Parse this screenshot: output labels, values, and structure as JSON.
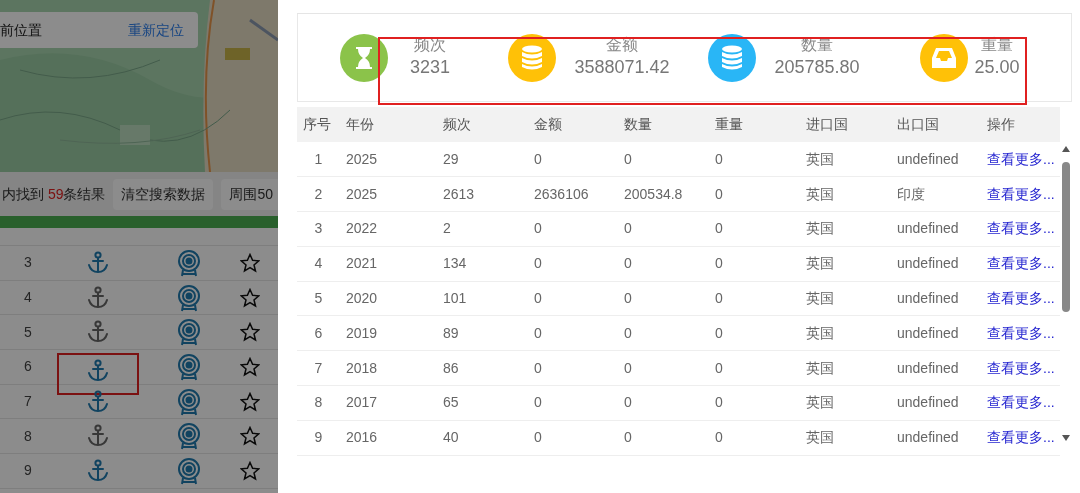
{
  "map_panel": {
    "location_card": {
      "label": "前位置",
      "action": "重新定位"
    },
    "result_bar": {
      "prefix": "内找到 ",
      "count": "59",
      "suffix": "条结果",
      "buttons": [
        "清空搜索数据",
        "周围50"
      ]
    },
    "rows": [
      {
        "index": "3",
        "active": true,
        "highlight": false
      },
      {
        "index": "4",
        "active": false,
        "highlight": false
      },
      {
        "index": "5",
        "active": false,
        "highlight": false
      },
      {
        "index": "6",
        "active": true,
        "highlight": true
      },
      {
        "index": "7",
        "active": true,
        "highlight": false
      },
      {
        "index": "8",
        "active": false,
        "highlight": false
      },
      {
        "index": "9",
        "active": true,
        "highlight": false
      }
    ]
  },
  "stats": {
    "highlight": true,
    "items": [
      {
        "kind": "hourglass",
        "label": "频次",
        "value": "3231",
        "color": "#8bc34a"
      },
      {
        "kind": "database",
        "label": "金额",
        "value": "3588071.42",
        "color": "#ffc107"
      },
      {
        "kind": "database",
        "label": "数量",
        "value": "205785.80",
        "color": "#29b6f6"
      },
      {
        "kind": "inbox",
        "label": "重量",
        "value": "25.00",
        "color": "#ffc107"
      }
    ]
  },
  "table": {
    "columns": [
      "序号",
      "年份",
      "频次",
      "金额",
      "数量",
      "重量",
      "进口国",
      "出口国",
      "操作"
    ],
    "rows": [
      [
        "1",
        "2025",
        "29",
        "0",
        "0",
        "0",
        "英国",
        "undefined",
        "查看更多..."
      ],
      [
        "2",
        "2025",
        "2613",
        "2636106",
        "200534.8",
        "0",
        "英国",
        "印度",
        "查看更多..."
      ],
      [
        "3",
        "2022",
        "2",
        "0",
        "0",
        "0",
        "英国",
        "undefined",
        "查看更多..."
      ],
      [
        "4",
        "2021",
        "134",
        "0",
        "0",
        "0",
        "英国",
        "undefined",
        "查看更多..."
      ],
      [
        "5",
        "2020",
        "101",
        "0",
        "0",
        "0",
        "英国",
        "undefined",
        "查看更多..."
      ],
      [
        "6",
        "2019",
        "89",
        "0",
        "0",
        "0",
        "英国",
        "undefined",
        "查看更多..."
      ],
      [
        "7",
        "2018",
        "86",
        "0",
        "0",
        "0",
        "英国",
        "undefined",
        "查看更多..."
      ],
      [
        "8",
        "2017",
        "65",
        "0",
        "0",
        "0",
        "英国",
        "undefined",
        "查看更多..."
      ],
      [
        "9",
        "2016",
        "40",
        "0",
        "0",
        "0",
        "英国",
        "undefined",
        "查看更多..."
      ]
    ]
  }
}
